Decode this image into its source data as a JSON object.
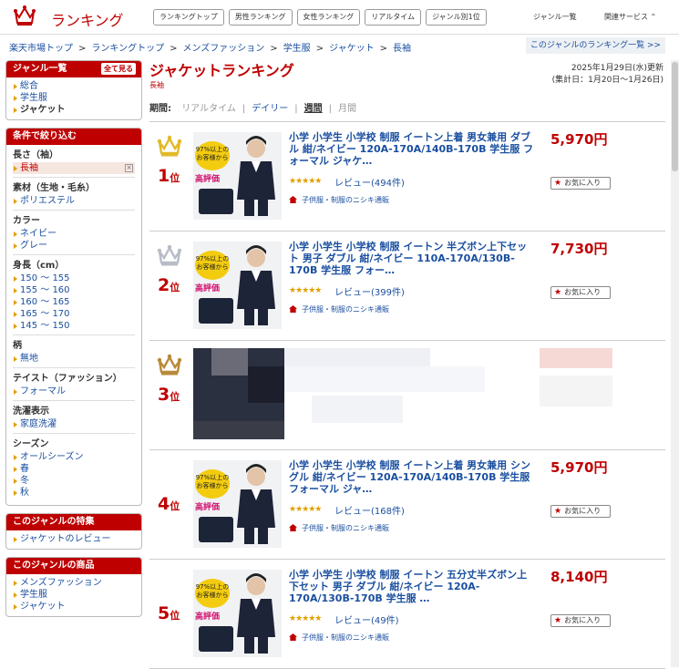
{
  "header": {
    "logo_text": "ランキング",
    "tabs": [
      "ランキングトップ",
      "男性ランキング",
      "女性ランキング",
      "リアルタイム",
      "ジャンル別1位"
    ],
    "genre_list": "ジャンル一覧",
    "related": "関連サービス"
  },
  "breadcrumb": {
    "items": [
      "楽天市場トップ",
      "ランキングトップ",
      "メンズファッション",
      "学生服",
      "ジャケット",
      "長袖"
    ],
    "sep": ">",
    "right_link": "このジャンルのランキング一覧 >>"
  },
  "sidebar": {
    "genre_box": {
      "title": "ジャンル一覧",
      "all_btn": "全て見る",
      "items": [
        "総合",
        "学生服",
        "ジャケット"
      ]
    },
    "filter_box": {
      "title": "条件で絞り込む",
      "groups": [
        {
          "title": "長さ（袖）",
          "items": [
            "長袖"
          ]
        },
        {
          "title": "素材（生地・毛糸）",
          "items": [
            "ポリエステル"
          ]
        },
        {
          "title": "カラー",
          "items": [
            "ネイビー",
            "グレー"
          ]
        },
        {
          "title": "身長（cm）",
          "items": [
            "150 ～ 155",
            "155 ～ 160",
            "160 ～ 165",
            "165 ～ 170",
            "145 ～ 150"
          ]
        },
        {
          "title": "柄",
          "items": [
            "無地"
          ]
        },
        {
          "title": "テイスト（ファッション）",
          "items": [
            "フォーマル"
          ]
        },
        {
          "title": "洗濯表示",
          "items": [
            "家庭洗濯"
          ]
        },
        {
          "title": "シーズン",
          "items": [
            "オールシーズン",
            "春",
            "冬",
            "秋"
          ]
        }
      ]
    },
    "feature_box": {
      "title": "このジャンルの特集",
      "items": [
        "ジャケットのレビュー"
      ]
    },
    "products_box": {
      "title": "このジャンルの商品",
      "items": [
        "メンズファッション",
        "学生服",
        "ジャケット"
      ]
    }
  },
  "main": {
    "title": "ジャケットランキング",
    "subtitle": "長袖",
    "updated": "2025年1月29日(水)更新",
    "period_range": "(集計日：1月20日～1月26日)",
    "period_label": "期間:",
    "periods": [
      "リアルタイム",
      "デイリー",
      "週間",
      "月間"
    ],
    "period_selected": "週間",
    "rank_suffix": "位",
    "fav_label": "お気に入り",
    "colors": {
      "accent": "#bf0000",
      "gold": "#e2b928",
      "silver": "#b8bcc6",
      "bronze": "#b88a3a"
    },
    "bubble_text": "97%以上の\nお客様から",
    "high_rating": "高評価",
    "items": [
      {
        "rank": "1",
        "crown": "gold",
        "name": "小学 小学生 小学校 制服 イートン上着 男女兼用 ダブル 紺/ネイビー 120A-170A/140B-170B 学生服 フォーマル ジャケ…",
        "price": "5,970円",
        "stars": "★★★★★",
        "review": "レビュー(494件)",
        "shop": "子供服・制服のニシキ通販"
      },
      {
        "rank": "2",
        "crown": "silver",
        "name": "小学 小学生 小学校 制服 イートン 半ズボン上下セット 男子 ダブル 紺/ネイビー 110A-170A/130B-170B 学生服 フォー…",
        "price": "7,730円",
        "stars": "★★★★★",
        "review": "レビュー(399件)",
        "shop": "子供服・制服のニシキ通販"
      },
      {
        "rank": "3",
        "crown": "bronze",
        "blurred": true
      },
      {
        "rank": "4",
        "crown": "none",
        "name": "小学 小学生 小学校 制服 イートン上着 男女兼用 シングル 紺/ネイビー 120A-170A/140B-170B 学生服 フォーマル ジャ…",
        "price": "5,970円",
        "stars": "★★★★★",
        "review": "レビュー(168件)",
        "shop": "子供服・制服のニシキ通販"
      },
      {
        "rank": "5",
        "crown": "none",
        "name": "小学 小学生 小学校 制服 イートン 五分丈半ズボン上下セット 男子 ダブル 紺/ネイビー 120A-170A/130B-170B 学生服 …",
        "price": "8,140円",
        "stars": "★★★★★",
        "review": "レビュー(49件)",
        "shop": "子供服・制服のニシキ通販"
      }
    ]
  }
}
